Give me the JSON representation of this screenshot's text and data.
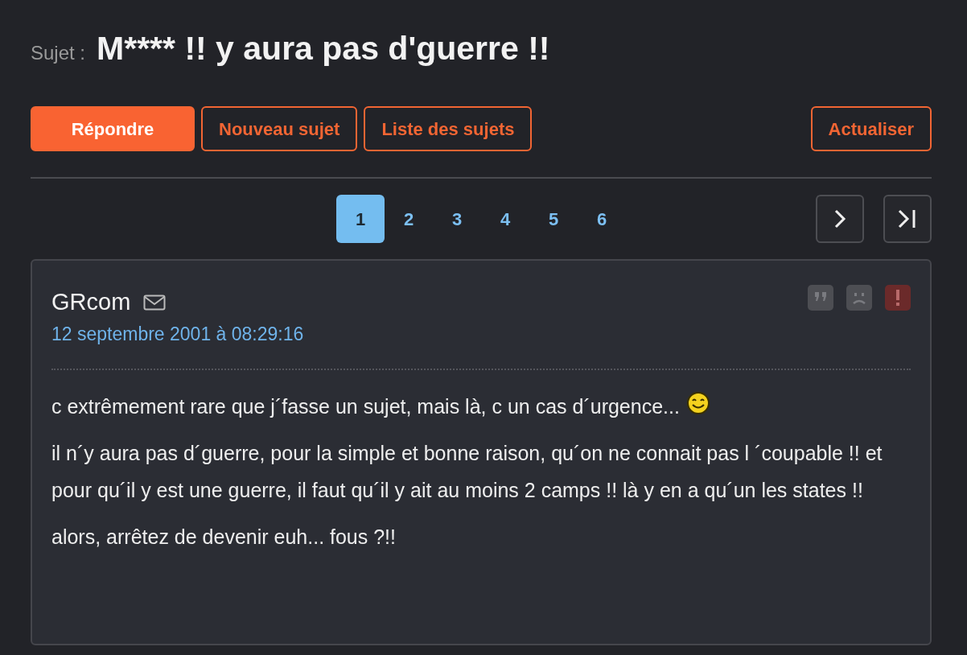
{
  "topic": {
    "label": "Sujet :",
    "title": "M**** !! y aura pas d'guerre !!"
  },
  "buttons": [
    {
      "label": "Répondre",
      "kind": "primary"
    },
    {
      "label": "Nouveau sujet",
      "kind": "outline"
    },
    {
      "label": "Liste des sujets",
      "kind": "outline"
    }
  ],
  "refresh_button": {
    "label": "Actualiser"
  },
  "pagination": {
    "pages": [
      {
        "label": "1",
        "selected": true
      },
      {
        "label": "2",
        "selected": false
      },
      {
        "label": "3",
        "selected": false
      },
      {
        "label": "4",
        "selected": false
      },
      {
        "label": "5",
        "selected": false
      },
      {
        "label": "6",
        "selected": false
      }
    ]
  },
  "post": {
    "author": "GRcom",
    "date": "12 septembre 2001 à 08:29:16",
    "actions": [
      {
        "kind": "quote"
      },
      {
        "kind": "sad"
      },
      {
        "kind": "report"
      }
    ],
    "paragraphs": [
      {
        "text": "c extrêmement rare que j´fasse un sujet, mais là, c un cas d´urgence...",
        "smiley": true
      },
      {
        "text": "il n´y aura pas d´guerre, pour la simple et bonne raison, qu´on ne connait pas l ´coupable !! et pour qu´il y est une guerre, il faut qu´il y ait au moins 2 camps !! là y en a qu´un les states !!",
        "smiley": false
      },
      {
        "text": "alors, arrêtez de devenir euh... fous ?!!",
        "smiley": false
      }
    ]
  }
}
